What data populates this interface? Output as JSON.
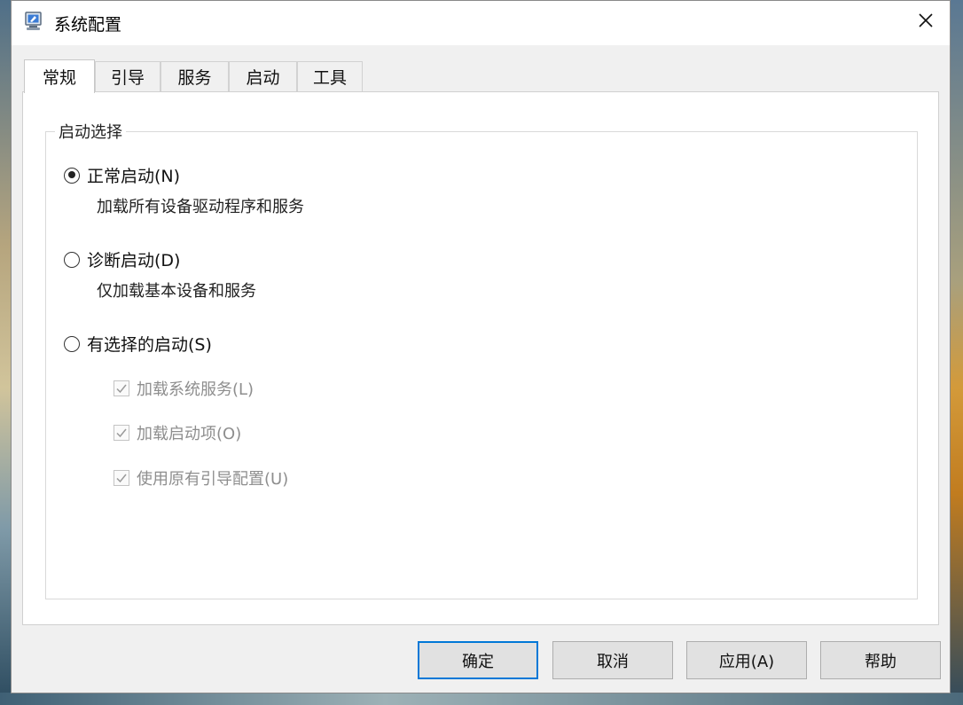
{
  "window": {
    "title": "系统配置"
  },
  "tabs": [
    {
      "label": "常规",
      "active": true
    },
    {
      "label": "引导",
      "active": false
    },
    {
      "label": "服务",
      "active": false
    },
    {
      "label": "启动",
      "active": false
    },
    {
      "label": "工具",
      "active": false
    }
  ],
  "startup_selection": {
    "legend": "启动选择",
    "options": [
      {
        "label": "正常启动(N)",
        "description": "加载所有设备驱动程序和服务",
        "selected": true
      },
      {
        "label": "诊断启动(D)",
        "description": "仅加载基本设备和服务",
        "selected": false
      },
      {
        "label": "有选择的启动(S)",
        "selected": false
      }
    ],
    "selective_items": [
      {
        "label": "加载系统服务(L)",
        "checked": true,
        "enabled": false
      },
      {
        "label": "加载启动项(O)",
        "checked": true,
        "enabled": false
      },
      {
        "label": "使用原有引导配置(U)",
        "checked": true,
        "enabled": false
      }
    ]
  },
  "buttons": {
    "ok": "确定",
    "cancel": "取消",
    "apply": "应用(A)",
    "help": "帮助"
  },
  "colors": {
    "accent": "#0078d7",
    "disabled_text": "#8e8e8e"
  }
}
